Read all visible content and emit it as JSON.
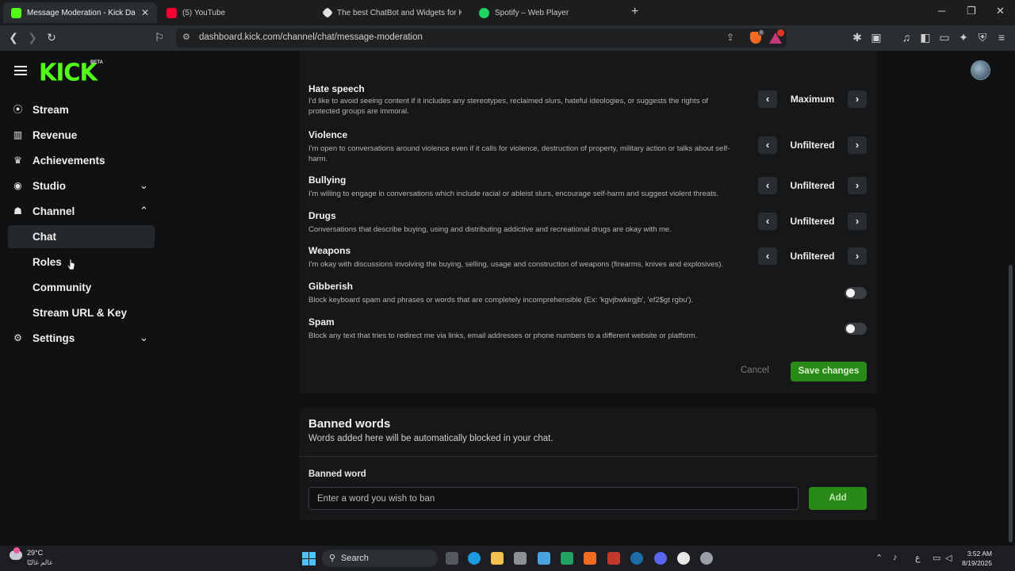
{
  "browser": {
    "tabs": [
      {
        "title": "Message Moderation - Kick Dash",
        "active": true,
        "favicon_color": "#53fc18"
      },
      {
        "title": "(5) YouTube",
        "active": false,
        "favicon_color": "#ff0033"
      },
      {
        "title": "The best ChatBot and Widgets for Kic",
        "active": false,
        "favicon_color": "#e0e0e0"
      },
      {
        "title": "Spotify – Web Player",
        "active": false,
        "favicon_color": "#1ed760"
      }
    ],
    "url": "dashboard.kick.com/channel/chat/message-moderation",
    "brave_badge": "8"
  },
  "app": {
    "logo": "KICK",
    "logo_badge": "BETA",
    "accent": "#53fc18"
  },
  "sidebar": {
    "items": [
      {
        "label": "Stream",
        "icon": "stream-icon"
      },
      {
        "label": "Revenue",
        "icon": "chart-icon"
      },
      {
        "label": "Achievements",
        "icon": "trophy-icon"
      },
      {
        "label": "Studio",
        "icon": "studio-icon",
        "expanded": false
      },
      {
        "label": "Channel",
        "icon": "channel-icon",
        "expanded": true
      },
      {
        "label": "Chat",
        "active": true
      },
      {
        "label": "Roles"
      },
      {
        "label": "Community"
      },
      {
        "label": "Stream URL & Key"
      },
      {
        "label": "Settings",
        "icon": "gear-icon",
        "expanded": false
      }
    ]
  },
  "moderation": {
    "categories": [
      {
        "title": "Hate speech",
        "desc": "I'd like to avoid seeing content if it includes any stereotypes, reclaimed slurs, hateful ideologies, or suggests the rights of protected groups are immoral.",
        "level": "Maximum"
      },
      {
        "title": "Violence",
        "desc": "I'm open to conversations around violence even if it calls for violence, destruction of property, military action or talks about self-harm.",
        "level": "Unfiltered"
      },
      {
        "title": "Bullying",
        "desc": "I'm willing to engage in conversations which include racial or ableist slurs, encourage self-harm and suggest violent threats.",
        "level": "Unfiltered"
      },
      {
        "title": "Drugs",
        "desc": "Conversations that describe buying, using and distributing addictive and recreational drugs are okay with me.",
        "level": "Unfiltered"
      },
      {
        "title": "Weapons",
        "desc": "I'm okay with discussions involving the buying, selling, usage and construction of weapons (firearms, knives and explosives).",
        "level": "Unfiltered"
      },
      {
        "title": "Gibberish",
        "desc": "Block keyboard spam and phrases or words that are completely incomprehensible (Ex: 'kgvjbwkirgjb', 'ef2$gt rgbu').",
        "toggle": false
      },
      {
        "title": "Spam",
        "desc": "Block any text that tries to redirect me via links, email addresses or phone numbers to a different website or platform.",
        "toggle": false
      }
    ],
    "cancel_label": "Cancel",
    "save_label": "Save changes"
  },
  "banned_words": {
    "title": "Banned words",
    "subtitle": "Words added here will be automatically blocked in your chat.",
    "field_label": "Banned word",
    "placeholder": "Enter a word you wish to ban",
    "add_label": "Add"
  },
  "taskbar": {
    "temperature": "29°C",
    "weather_desc": "عالم غالبًا",
    "search_label": "Search",
    "time": "3:52 AM",
    "date": "8/19/2025",
    "language": "ع"
  }
}
